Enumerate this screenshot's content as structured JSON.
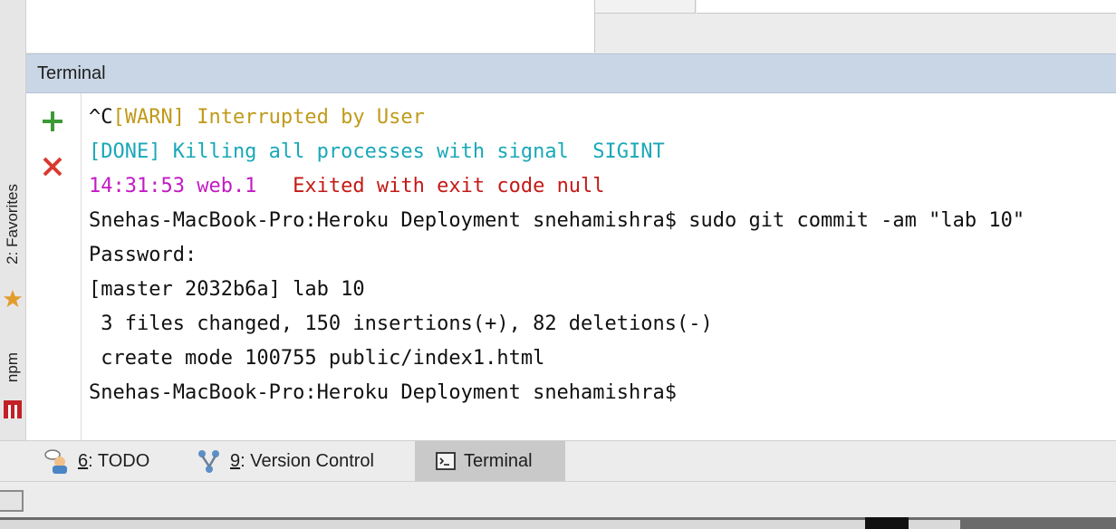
{
  "left_strip": {
    "favorites_label": "2: Favorites",
    "npm_label": "npm"
  },
  "terminal": {
    "title": "Terminal",
    "lines": [
      {
        "parts": [
          {
            "text": "^C",
            "color": "#111111"
          },
          {
            "text": "[WARN] Interrupted by User",
            "color": "#c09a1a"
          }
        ]
      },
      {
        "parts": [
          {
            "text": "[DONE] Killing all processes with signal  SIGINT",
            "color": "#1aa8b8"
          }
        ]
      },
      {
        "parts": [
          {
            "text": "14:31:53 web.1   ",
            "color": "#c21bc4"
          },
          {
            "text": "Exited with exit code null",
            "color": "#c41a16"
          }
        ]
      },
      {
        "parts": [
          {
            "text": "Snehas-MacBook-Pro:Heroku Deployment snehamishra$ sudo git commit -am \"lab 10\"",
            "color": "#111111"
          }
        ]
      },
      {
        "parts": [
          {
            "text": "Password:",
            "color": "#111111"
          }
        ]
      },
      {
        "parts": [
          {
            "text": "[master 2032b6a] lab 10",
            "color": "#111111"
          }
        ]
      },
      {
        "parts": [
          {
            "text": " 3 files changed, 150 insertions(+), 82 deletions(-)",
            "color": "#111111"
          }
        ]
      },
      {
        "parts": [
          {
            "text": " create mode 100755 public/index1.html",
            "color": "#111111"
          }
        ]
      },
      {
        "parts": [
          {
            "text": "Snehas-MacBook-Pro:Heroku Deployment snehamishra$",
            "color": "#111111"
          }
        ]
      }
    ],
    "new_session_icon": "plus-icon",
    "close_session_icon": "close-icon"
  },
  "bottom_tabs": {
    "todo": {
      "num": "6",
      "rest": ": TODO"
    },
    "vcs": {
      "num": "9",
      "rest": ": Version Control"
    },
    "terminal": {
      "label": "Terminal"
    }
  },
  "colors": {
    "header_bg": "#c9d6e6",
    "plus_green": "#3d9b36",
    "close_red": "#d9392f"
  }
}
